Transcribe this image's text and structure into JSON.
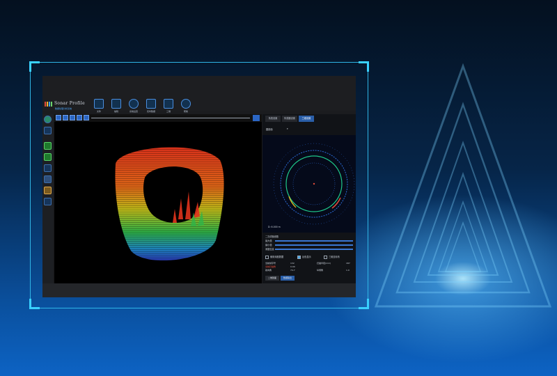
{
  "app": {
    "title": "Sonar Profile",
    "subtitle": "数据处理分析系统"
  },
  "toolbar": {
    "items": [
      {
        "label": "文件"
      },
      {
        "label": "编辑"
      },
      {
        "label": "系统设置"
      },
      {
        "label": "实时数据"
      },
      {
        "label": "三维"
      },
      {
        "label": "帮助"
      }
    ]
  },
  "tabs": [
    "系统设置",
    "传感器设置",
    "三维设置"
  ],
  "dropdown": {
    "value": "圆剖面"
  },
  "polar": {
    "distance": "D: 6.000 m"
  },
  "params": {
    "title": "二次成像参数",
    "rows": [
      {
        "label": "最大值"
      },
      {
        "label": "最小值"
      },
      {
        "label": "深度信息"
      }
    ]
  },
  "checks": [
    {
      "label": "使用深度数据"
    },
    {
      "label": "反色显示"
    },
    {
      "label": "三维坐标系"
    }
  ],
  "info": {
    "left": [
      {
        "label": "当前帧序号",
        "value": "132"
      },
      {
        "label": "当前扫描角",
        "value": "0.00"
      },
      {
        "label": "航向角",
        "value": "74.7"
      }
    ],
    "right": [
      {
        "label": "扫描半径(mm)",
        "value": "187"
      },
      {
        "label": "纵倾角",
        "value": "1.0"
      }
    ]
  },
  "bottom_buttons": [
    "二维剖面",
    "数据输出"
  ],
  "colors": {
    "accent": "#2a5ea8",
    "frame": "#2fb6e6"
  }
}
